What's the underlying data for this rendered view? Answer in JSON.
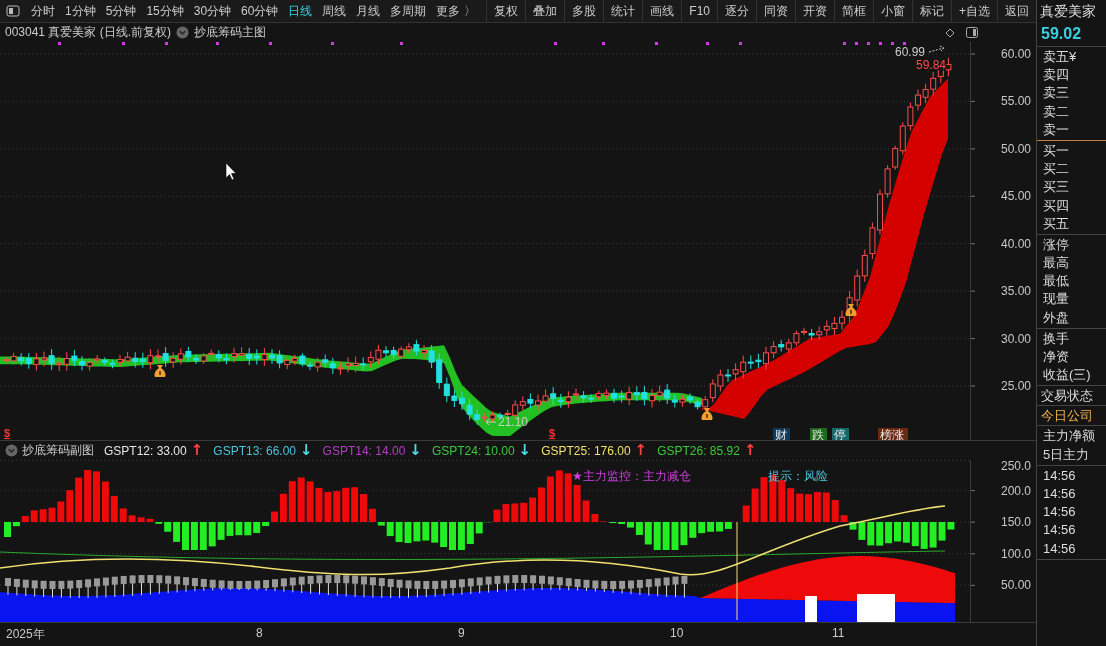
{
  "toolbar": {
    "periods": [
      {
        "label": "分时",
        "selected": false
      },
      {
        "label": "1分钟",
        "selected": false
      },
      {
        "label": "5分钟",
        "selected": false
      },
      {
        "label": "15分钟",
        "selected": false
      },
      {
        "label": "30分钟",
        "selected": false
      },
      {
        "label": "60分钟",
        "selected": false
      },
      {
        "label": "日线",
        "selected": true
      },
      {
        "label": "周线",
        "selected": false
      },
      {
        "label": "月线",
        "selected": false
      },
      {
        "label": "多周期",
        "selected": false
      },
      {
        "label": "更多 〉",
        "selected": false
      }
    ],
    "buttons": [
      "复权",
      "叠加",
      "多股",
      "统计",
      "画线",
      "F10",
      "逐分",
      "同资",
      "开资",
      "简框",
      "小窗",
      "标记",
      "+自选",
      "返回"
    ]
  },
  "info_bar": {
    "stock": "003041 真爱美家 (日线.前复权)",
    "indicator": "抄底筹码主图"
  },
  "main_chart": {
    "y_axis": [
      "60.00",
      "55.00",
      "50.00",
      "45.00",
      "40.00",
      "35.00",
      "30.00",
      "25.00"
    ],
    "high_label": "60.99",
    "last_label": "59.84",
    "low_label": "21.10",
    "signals": [
      "$",
      "$"
    ],
    "badges": [
      {
        "text": "财",
        "color": "#113a5a"
      },
      {
        "text": "跌",
        "color": "#1d6a1d"
      },
      {
        "text": "停",
        "color": "#136a6a"
      },
      {
        "text": "榜涨",
        "color": "#6a2a12"
      }
    ]
  },
  "sub_chart": {
    "title": "抄底筹码副图",
    "legend": [
      {
        "label": "GSPT12: 33.00",
        "arrow": {
          "text": "↑",
          "color": "#ff4040"
        },
        "color": "#e6e6e6"
      },
      {
        "label": "GSPT13: 66.00",
        "arrow": {
          "text": "↓",
          "color": "#4fd8e8"
        },
        "color": "#4fc3d9"
      },
      {
        "label": "GSPT14: 14.00",
        "arrow": {
          "text": "↓",
          "color": "#4fd8e8"
        },
        "color": "#b040c0"
      },
      {
        "label": "GSPT24: 10.00",
        "arrow": {
          "text": "↓",
          "color": "#4fd8e8"
        },
        "color": "#3cc83c"
      },
      {
        "label": "GSPT25: 176.00",
        "arrow": {
          "text": "↑",
          "color": "#ff4040"
        },
        "color": "#f0e070"
      },
      {
        "label": "GSPT26: 85.92",
        "arrow": {
          "text": "↑",
          "color": "#ff4040"
        },
        "color": "#3cc83c"
      }
    ],
    "monitor_note": "★主力监控：主力减仓",
    "hint_note": "提示：风险",
    "y_axis": [
      "250.0",
      "200.0",
      "150.0",
      "100.0",
      "50.00"
    ]
  },
  "x_axis": [
    "2025年",
    "8",
    "9",
    "10",
    "11"
  ],
  "quote_panel": {
    "name": "真爱美家",
    "price": "59.02",
    "groups": [
      [
        "卖五¥",
        "卖四",
        "卖三",
        "卖二",
        "卖一"
      ],
      [
        "买一",
        "买二",
        "买三",
        "买四",
        "买五"
      ],
      [
        "涨停",
        "最高",
        "最低",
        "现量",
        "外盘"
      ],
      [
        "换手",
        "净资",
        "收益(三)"
      ]
    ],
    "status": "交易状态",
    "company": "今日公司",
    "flows": [
      "主力净额",
      "5日主力"
    ],
    "times": [
      "14:56",
      "14:56",
      "14:56",
      "14:56",
      "14:56"
    ]
  }
}
